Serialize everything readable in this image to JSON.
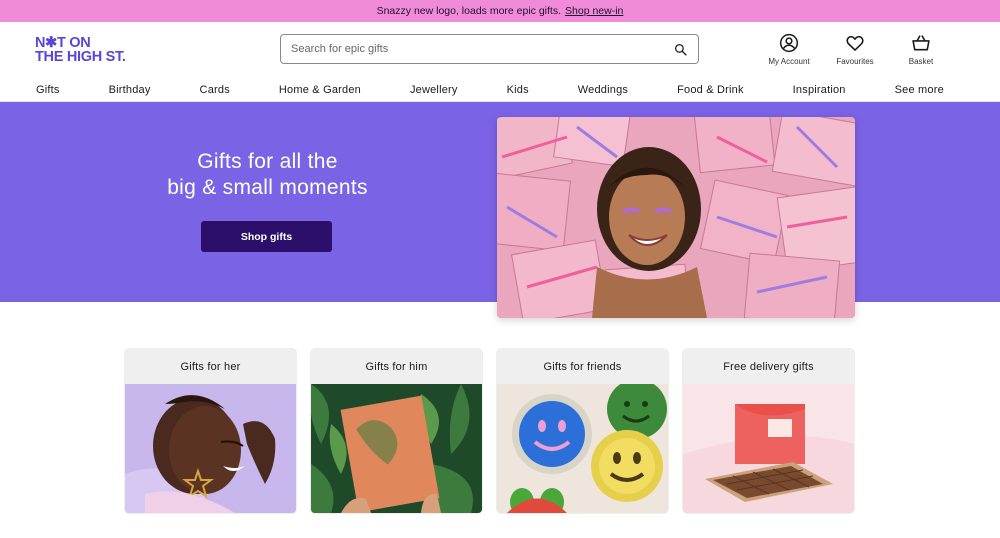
{
  "promo": {
    "text": "Snazzy new logo, loads more epic gifts.",
    "link": "Shop new-in"
  },
  "logo": {
    "line1": "N✱T ON",
    "line2": "THE HIGH ST."
  },
  "search": {
    "placeholder": "Search for epic gifts"
  },
  "actions": [
    {
      "label": "My Account",
      "icon": "account-icon"
    },
    {
      "label": "Favourites",
      "icon": "heart-icon"
    },
    {
      "label": "Basket",
      "icon": "basket-icon"
    }
  ],
  "nav": [
    "Gifts",
    "Birthday",
    "Cards",
    "Home & Garden",
    "Jewellery",
    "Kids",
    "Weddings",
    "Food & Drink",
    "Inspiration",
    "See more"
  ],
  "hero": {
    "line1": "Gifts for all the",
    "line2": "big & small moments",
    "button": "Shop gifts"
  },
  "cards": [
    {
      "title": "Gifts for her"
    },
    {
      "title": "Gifts for him"
    },
    {
      "title": "Gifts for friends"
    },
    {
      "title": "Free delivery gifts"
    }
  ],
  "colors": {
    "promo": "#f08bd8",
    "brand": "#5b45d6",
    "hero_band": "#7b63e6",
    "hero_button": "#2b0f6b"
  }
}
